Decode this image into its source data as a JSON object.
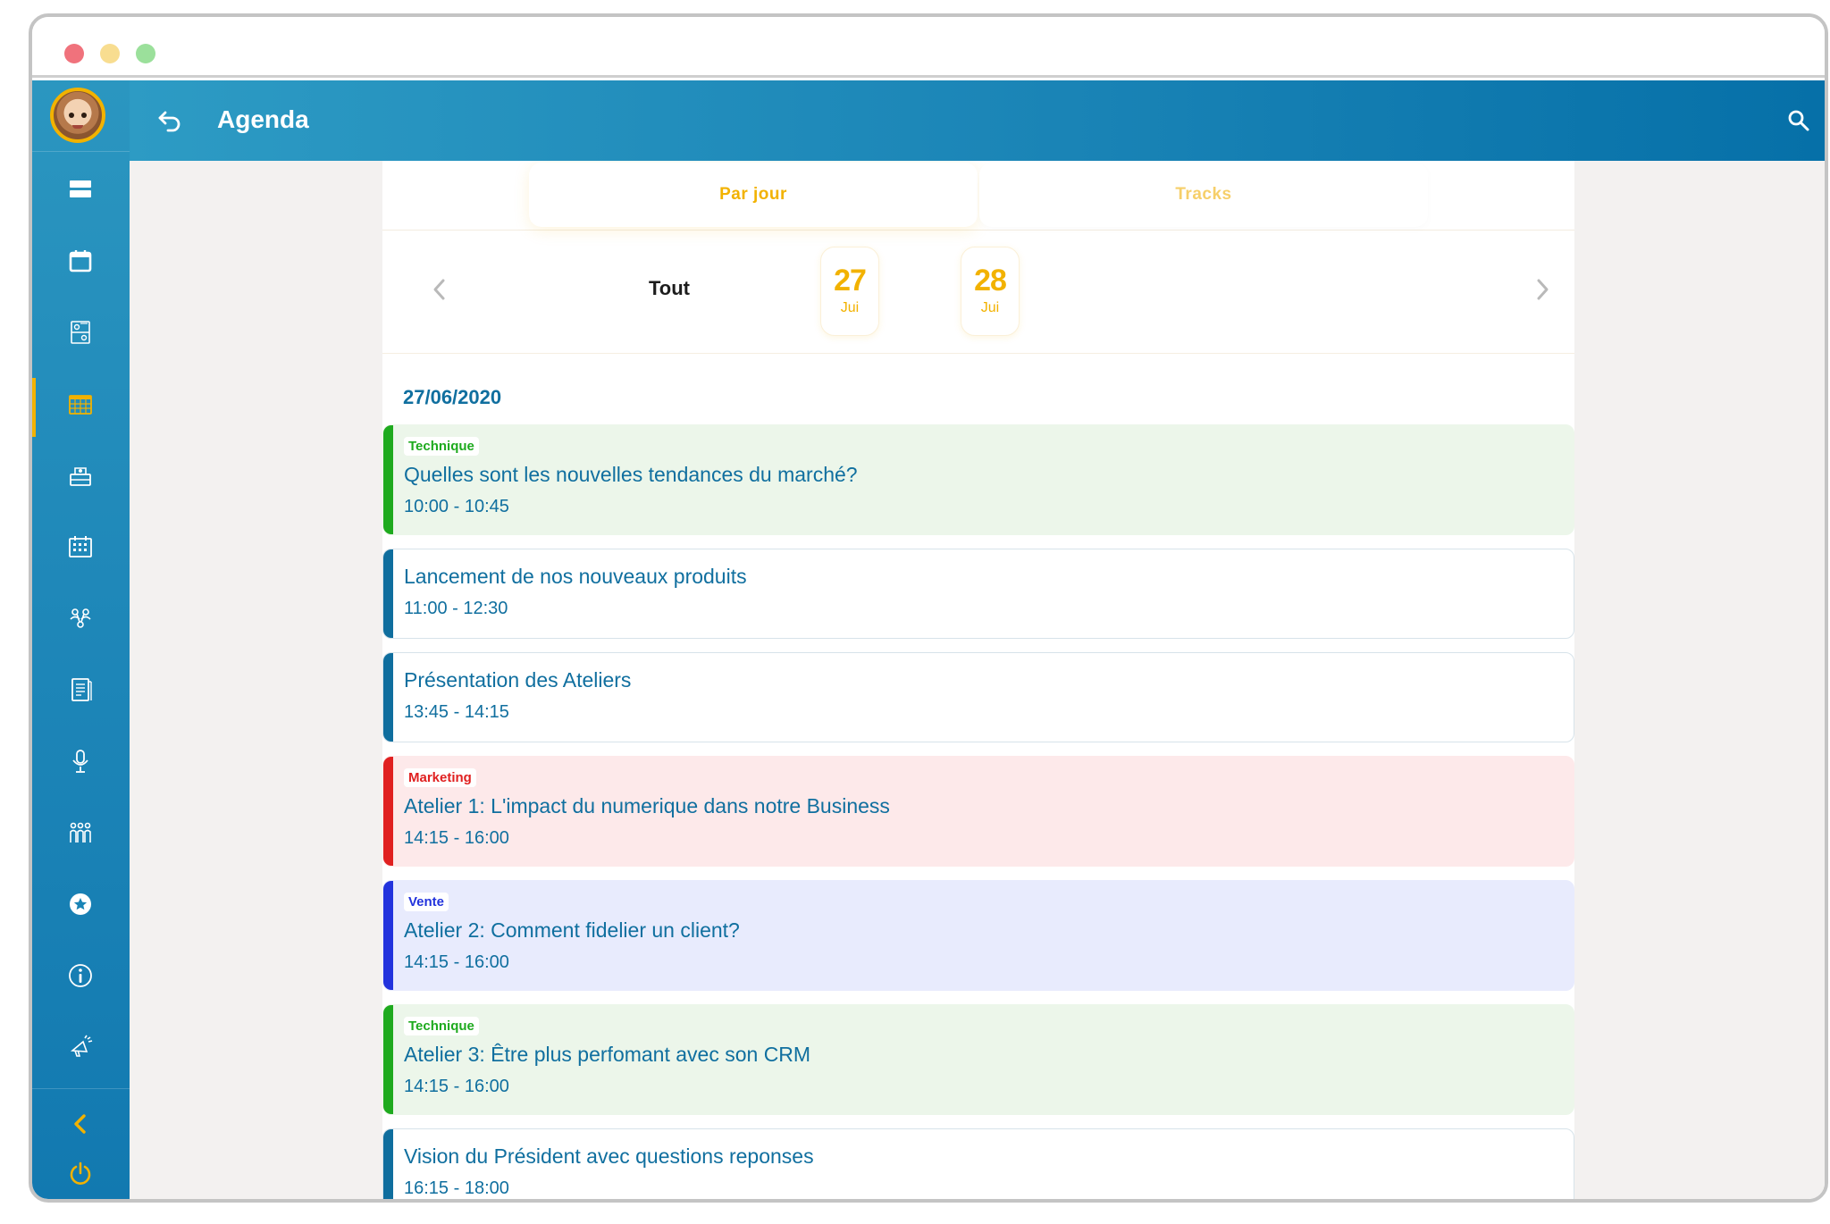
{
  "app": {
    "title": "Agenda"
  },
  "colors": {
    "header_start": "#2d9bc4",
    "header_end": "#0670a8",
    "accent": "#f2b200",
    "text_blue": "#106f9f",
    "technique": "#1eaa1e",
    "marketing": "#e02020",
    "vente": "#2233dd",
    "default": "#0f6e9e"
  },
  "sidebar": {
    "items": [
      {
        "icon": "list-icon",
        "active": false
      },
      {
        "icon": "calendar-icon",
        "active": false
      },
      {
        "icon": "floor-plan-icon",
        "active": false
      },
      {
        "icon": "agenda-grid-icon",
        "active": true
      },
      {
        "icon": "exhibitors-icon",
        "active": false
      },
      {
        "icon": "schedule-icon",
        "active": false
      },
      {
        "icon": "networking-icon",
        "active": false
      },
      {
        "icon": "documents-icon",
        "active": false
      },
      {
        "icon": "microphone-icon",
        "active": false
      },
      {
        "icon": "attendees-icon",
        "active": false
      },
      {
        "icon": "star-icon",
        "active": false
      },
      {
        "icon": "info-icon",
        "active": false
      },
      {
        "icon": "megaphone-icon",
        "active": false
      }
    ],
    "collapse_icon": "chevron-left-icon",
    "logout_icon": "power-icon"
  },
  "tabs": [
    {
      "label": "Par jour",
      "active": true
    },
    {
      "label": "Tracks",
      "active": false
    }
  ],
  "date_filter": {
    "all_label": "Tout",
    "days": [
      {
        "number": "27",
        "month": "Jui"
      },
      {
        "number": "28",
        "month": "Jui"
      }
    ]
  },
  "date_heading": "27/06/2020",
  "sessions": [
    {
      "tag": "Technique",
      "track": "technique",
      "title": "Quelles sont les nouvelles tendances du marché?",
      "time": "10:00 - 10:45"
    },
    {
      "tag": "",
      "track": "default",
      "title": "Lancement de nos nouveaux produits",
      "time": "11:00 - 12:30"
    },
    {
      "tag": "",
      "track": "default",
      "title": "Présentation des Ateliers",
      "time": "13:45 - 14:15"
    },
    {
      "tag": "Marketing",
      "track": "marketing",
      "title": "Atelier 1: L'impact du numerique dans notre Business",
      "time": "14:15 - 16:00"
    },
    {
      "tag": "Vente",
      "track": "vente",
      "title": "Atelier 2: Comment fidelier un client?",
      "time": "14:15 - 16:00"
    },
    {
      "tag": "Technique",
      "track": "technique",
      "title": "Atelier 3: Être plus perfomant avec son CRM",
      "time": "14:15 - 16:00"
    },
    {
      "tag": "",
      "track": "default",
      "title": "Vision du Président avec questions reponses",
      "time": "16:15 - 18:00"
    }
  ]
}
